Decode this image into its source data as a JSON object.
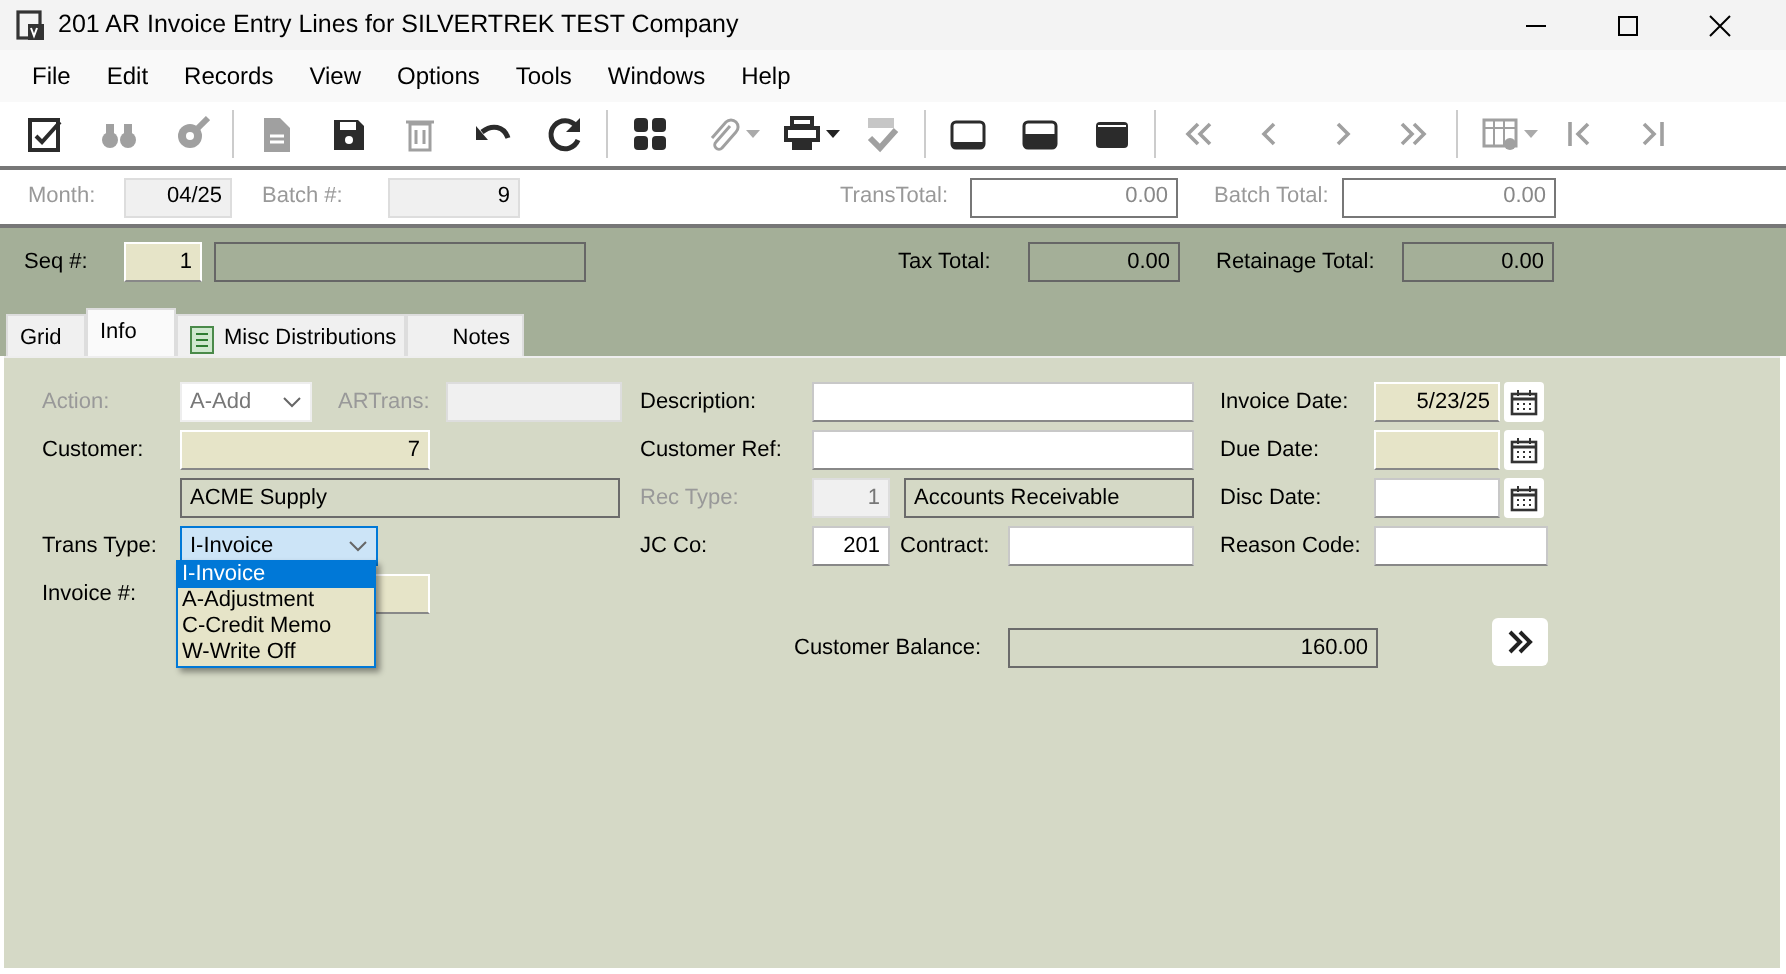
{
  "window": {
    "title": "201 AR Invoice Entry Lines for SILVERTREK TEST Company"
  },
  "menu": [
    "File",
    "Edit",
    "Records",
    "View",
    "Options",
    "Tools",
    "Windows",
    "Help"
  ],
  "toolbar": [
    {
      "kind": "edit",
      "disabled": false
    },
    {
      "kind": "find",
      "disabled": true
    },
    {
      "kind": "tools",
      "disabled": true
    },
    {
      "kind": "separator"
    },
    {
      "kind": "new",
      "disabled": true
    },
    {
      "kind": "save",
      "disabled": false
    },
    {
      "kind": "delete",
      "disabled": true
    },
    {
      "kind": "undo",
      "disabled": false
    },
    {
      "kind": "refresh",
      "disabled": false
    },
    {
      "kind": "separator"
    },
    {
      "kind": "calculator",
      "disabled": false
    },
    {
      "kind": "attach",
      "disabled": true,
      "has_menu": true
    },
    {
      "kind": "print",
      "disabled": false,
      "has_menu": true
    },
    {
      "kind": "spellcheck",
      "disabled": true
    },
    {
      "kind": "separator"
    },
    {
      "kind": "layout-bottom",
      "disabled": false
    },
    {
      "kind": "layout-split",
      "disabled": false
    },
    {
      "kind": "layout-full",
      "disabled": false
    },
    {
      "kind": "separator"
    },
    {
      "kind": "first",
      "disabled": true
    },
    {
      "kind": "prev",
      "disabled": true
    },
    {
      "kind": "next",
      "disabled": true
    },
    {
      "kind": "last",
      "disabled": true
    },
    {
      "kind": "separator"
    },
    {
      "kind": "grid-settings",
      "disabled": true,
      "has_menu": true
    },
    {
      "kind": "start",
      "disabled": true
    },
    {
      "kind": "end",
      "disabled": true
    }
  ],
  "header": {
    "month": {
      "label": "Month:",
      "value": "04/25"
    },
    "batch": {
      "label": "Batch #:",
      "value": "9"
    },
    "trans_total": {
      "label": "TransTotal:",
      "value": "0.00"
    },
    "batch_total": {
      "label": "Batch Total:",
      "value": "0.00"
    }
  },
  "summary": {
    "seq": {
      "label": "Seq #:",
      "value": "1"
    },
    "tax_total": {
      "label": "Tax Total:",
      "value": "0.00"
    },
    "retainage_total": {
      "label": "Retainage Total:",
      "value": "0.00"
    }
  },
  "tabs": [
    {
      "label": "Grid",
      "selected": false
    },
    {
      "label": "Info",
      "selected": true
    },
    {
      "label": "Misc Distributions",
      "selected": false,
      "icon": true
    },
    {
      "label": "Notes",
      "selected": false
    }
  ],
  "form": {
    "action": {
      "label": "Action:",
      "value": "A-Add",
      "kind": "disabled"
    },
    "artrans": {
      "label": "ARTrans:",
      "kind": "disabled"
    },
    "customer": {
      "label": "Customer:",
      "value": "7",
      "kind": "required"
    },
    "customer_name": {
      "value": "ACME Supply",
      "kind": "readonly"
    },
    "trans_type": {
      "label": "Trans Type:",
      "value": "I-Invoice",
      "expanded": true,
      "options": [
        {
          "label": "I-Invoice",
          "selected": true
        },
        {
          "label": "A-Adjustment",
          "selected": false
        },
        {
          "label": "C-Credit Memo",
          "selected": false
        },
        {
          "label": "W-Write Off",
          "selected": false
        }
      ]
    },
    "invoice_no": {
      "label": "Invoice #:",
      "kind": "required"
    },
    "description": {
      "label": "Description:",
      "kind": "input"
    },
    "customer_ref": {
      "label": "Customer Ref:",
      "kind": "input"
    },
    "rec_type": {
      "label": "Rec Type:",
      "value": "1",
      "kind": "disabled"
    },
    "rec_type_name": {
      "value": "Accounts Receivable",
      "kind": "readonly"
    },
    "jc_co": {
      "label": "JC Co:",
      "value": "201",
      "kind": "input"
    },
    "contract": {
      "label": "Contract:",
      "kind": "input"
    },
    "invoice_date": {
      "label": "Invoice Date:",
      "value": "5/23/25",
      "kind": "required"
    },
    "due_date": {
      "label": "Due Date:",
      "kind": "required"
    },
    "disc_date": {
      "label": "Disc Date:",
      "kind": "input"
    },
    "reason_code": {
      "label": "Reason Code:",
      "kind": "input"
    },
    "customer_balance": {
      "label": "Customer Balance:",
      "value": "160.00",
      "kind": "readonly"
    }
  }
}
